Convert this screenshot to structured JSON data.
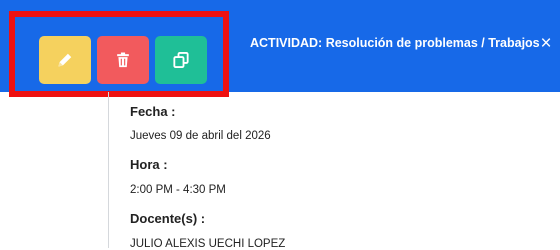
{
  "header": {
    "title": "ACTIVIDAD: Resolución de problemas / Trabajos",
    "close_label": "×",
    "actions": [
      {
        "name": "edit",
        "icon": "pencil-icon",
        "color": "#f5d15e"
      },
      {
        "name": "delete",
        "icon": "trash-icon",
        "color": "#f25a5d"
      },
      {
        "name": "copy",
        "icon": "copy-icon",
        "color": "#1fbf97"
      }
    ],
    "background": "#1769e8",
    "highlight_color": "#ee1111"
  },
  "details": {
    "date_label": "Fecha :",
    "date_value": "Jueves 09 de abril del 2026",
    "time_label": "Hora :",
    "time_value": "2:00 PM - 4:30 PM",
    "teacher_label": "Docente(s) :",
    "teacher_value": "JULIO ALEXIS UECHI LOPEZ"
  }
}
